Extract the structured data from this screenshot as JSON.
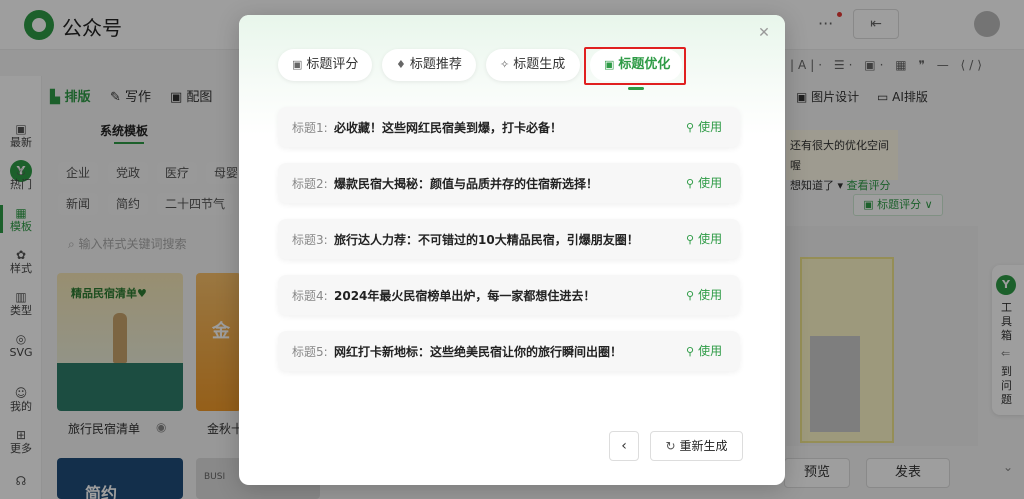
{
  "app": {
    "name": "公众号"
  },
  "left_rail": [
    {
      "label": "最新",
      "icon": "new-icon"
    },
    {
      "label": "热门",
      "icon": "fire-icon"
    },
    {
      "label": "模板",
      "icon": "template-icon",
      "active": true
    },
    {
      "label": "样式",
      "icon": "style-icon"
    },
    {
      "label": "类型",
      "icon": "type-icon"
    },
    {
      "label": "SVG",
      "icon": "svg-icon"
    },
    {
      "label": "我的",
      "icon": "user-icon"
    },
    {
      "label": "更多",
      "icon": "more-icon"
    }
  ],
  "tool_tabs": [
    {
      "label": "排版",
      "active": true
    },
    {
      "label": "写作"
    },
    {
      "label": "配图"
    }
  ],
  "template_panel": {
    "sub_tab": "系统模板",
    "chips_row1": [
      "企业",
      "党政",
      "医疗",
      "母婴"
    ],
    "chips_row2": [
      "新闻",
      "简约",
      "二十四节气"
    ],
    "search_placeholder": "输入样式关键词搜索",
    "cards": [
      {
        "title_art": "精品民宿清单♥",
        "label": "旅行民宿清单"
      },
      {
        "title_art": "金",
        "label": "金秋十"
      },
      {
        "title_art": "简约"
      },
      {
        "title_art": "BUSI"
      }
    ]
  },
  "right_panel": {
    "toolbar_symbols": "|A|· ☰· ▣· ▦ ❞ — ⟨/⟩",
    "image_design": "图片设计",
    "ai_layout": "AI排版",
    "hint_line1": "还有很大的优化空间喔",
    "hint_line2": "想知道了",
    "hint_link": "查看评分",
    "score_pill": "标题评分",
    "dock_letters": [
      "工",
      "具",
      "箱"
    ],
    "dock_letters2": [
      "到",
      "问",
      "题"
    ],
    "preview": "预览",
    "publish": "发表"
  },
  "modal": {
    "tabs": [
      {
        "label": "标题评分",
        "icon": "score-icon"
      },
      {
        "label": "标题推荐",
        "icon": "thumbs-up-icon"
      },
      {
        "label": "标题生成",
        "icon": "sparkle-icon"
      },
      {
        "label": "标题优化",
        "icon": "optimize-icon",
        "active": true
      }
    ],
    "titles": [
      {
        "prefix": "标题1:",
        "text": "必收藏！这些网红民宿美到爆，打卡必备！",
        "use": "使用"
      },
      {
        "prefix": "标题2:",
        "text": "爆款民宿大揭秘：颜值与品质并存的住宿新选择！",
        "use": "使用"
      },
      {
        "prefix": "标题3:",
        "text": "旅行达人力荐：不可错过的10大精品民宿，引爆朋友圈！",
        "use": "使用"
      },
      {
        "prefix": "标题4:",
        "text": "2024年最火民宿榜单出炉，每一家都想住进去！",
        "use": "使用"
      },
      {
        "prefix": "标题5:",
        "text": "网红打卡新地标：这些绝美民宿让你的旅行瞬间出圈！",
        "use": "使用"
      }
    ],
    "back_label": "‹",
    "regenerate_label": "重新生成"
  },
  "colors": {
    "accent": "#2e9b46",
    "highlight_border": "#e02020"
  }
}
